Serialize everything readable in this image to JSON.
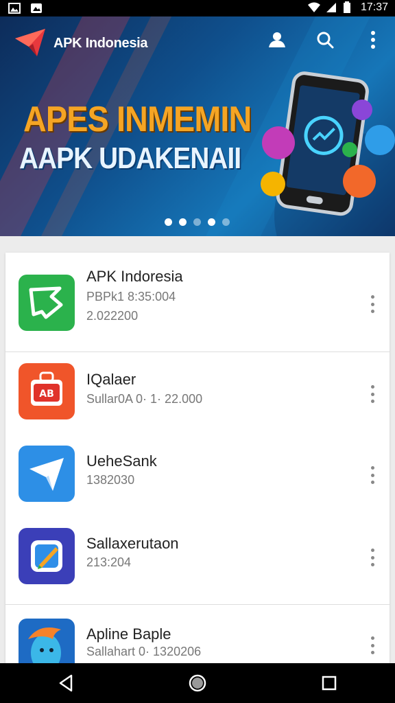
{
  "status_bar": {
    "time": "17:37"
  },
  "header": {
    "brand_name": "APK Indonesia",
    "actions": [
      "account-icon",
      "search-icon",
      "overflow-menu-icon"
    ]
  },
  "banner": {
    "headline_primary": "APES INMEMIN",
    "headline_secondary": "AAPK UDAKENAII",
    "carousel": {
      "total": 5,
      "active": 3
    }
  },
  "apps": [
    {
      "name": "APK Indoresia",
      "line1": "PBPk1 8:35:004",
      "line2": "2.022200",
      "icon": "green-bird-icon"
    },
    {
      "name": "IQalaer",
      "line1": "Sullar0A 0·  1· 22.000",
      "line2": "",
      "icon": "orange-store-icon"
    },
    {
      "name": "UeheSank",
      "line1": "1382030",
      "line2": "",
      "icon": "blue-plane-icon"
    },
    {
      "name": "Sallaxerutaon",
      "line1": "213:204",
      "line2": "",
      "icon": "purple-pen-icon"
    },
    {
      "name": "Apline Baple",
      "line1": "Sallahart 0·  1320206",
      "line2": "",
      "icon": "avatar-icon"
    }
  ],
  "colors": {
    "accent_orange": "#f5a524",
    "banner_blue": "#0f4f8c",
    "green": "#2bb24c"
  },
  "nav": [
    "back-icon",
    "home-icon",
    "recents-icon"
  ]
}
